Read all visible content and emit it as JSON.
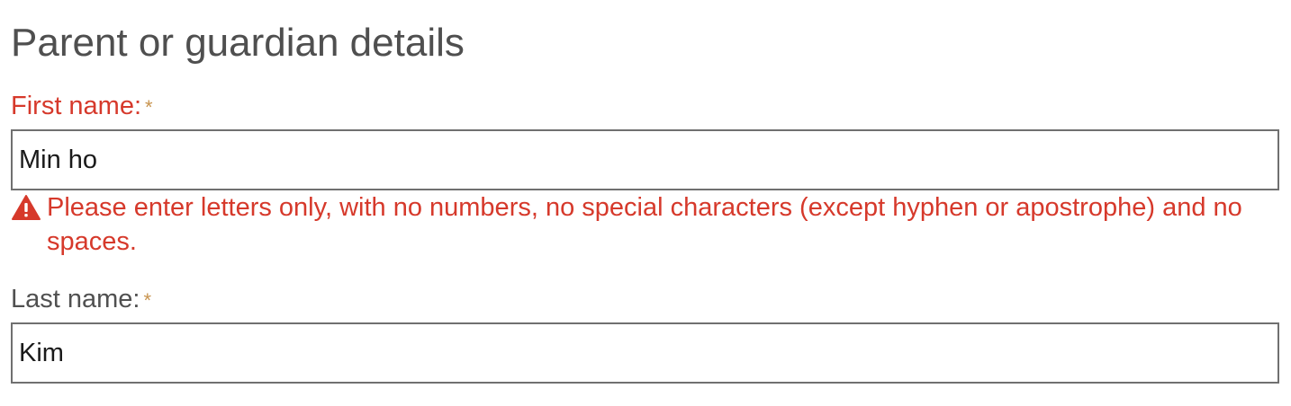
{
  "section": {
    "title": "Parent or guardian details"
  },
  "fields": {
    "first_name": {
      "label": "First name:",
      "required_marker": "*",
      "value": "Min ho",
      "error": "Please enter letters only, with no numbers, no special characters (except hyphen or apostrophe) and no spaces.",
      "error_icon": "warning-icon"
    },
    "last_name": {
      "label": "Last name:",
      "required_marker": "*",
      "value": "Kim"
    }
  },
  "colors": {
    "error": "#d6392b",
    "required": "#c8944f",
    "text": "#505050",
    "border": "#707070"
  }
}
